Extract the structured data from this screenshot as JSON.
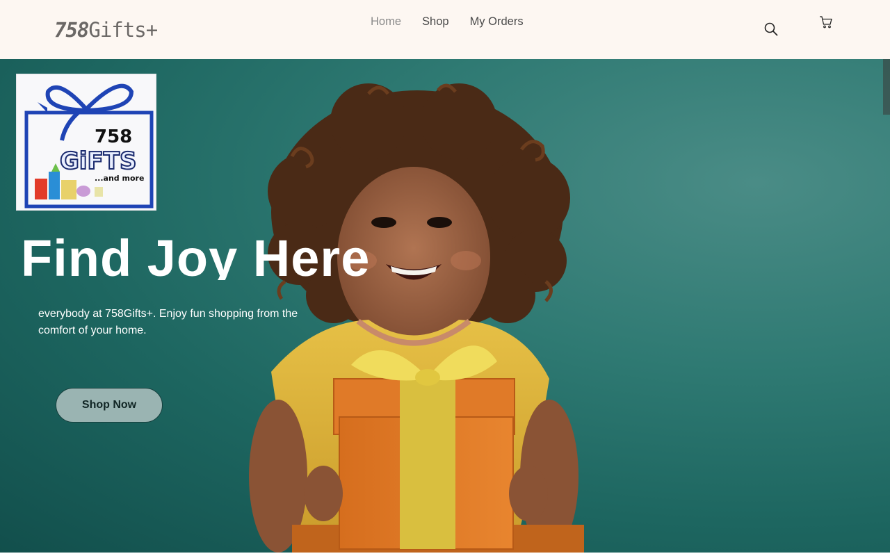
{
  "header": {
    "brand_num": "758",
    "brand_text": "Gifts+",
    "nav": [
      {
        "label": "Home"
      },
      {
        "label": "Shop"
      },
      {
        "label": "My Orders"
      }
    ],
    "icons": {
      "search": "search-icon",
      "cart": "cart-icon"
    }
  },
  "logo": {
    "line1": "758",
    "line2": "GiFTS",
    "line3": "...and more"
  },
  "hero": {
    "headline": "Find Joy Here",
    "subtext": "everybody at 758Gifts+. Enjoy fun shopping from the comfort of your home.",
    "cta": "Shop Now"
  },
  "colors": {
    "header_bg": "#fdf7f2",
    "hero_teal": "#1d6660",
    "gift_box": "#e8832a",
    "ribbon": "#e7c74a",
    "logo_blue": "#1f44b5"
  }
}
